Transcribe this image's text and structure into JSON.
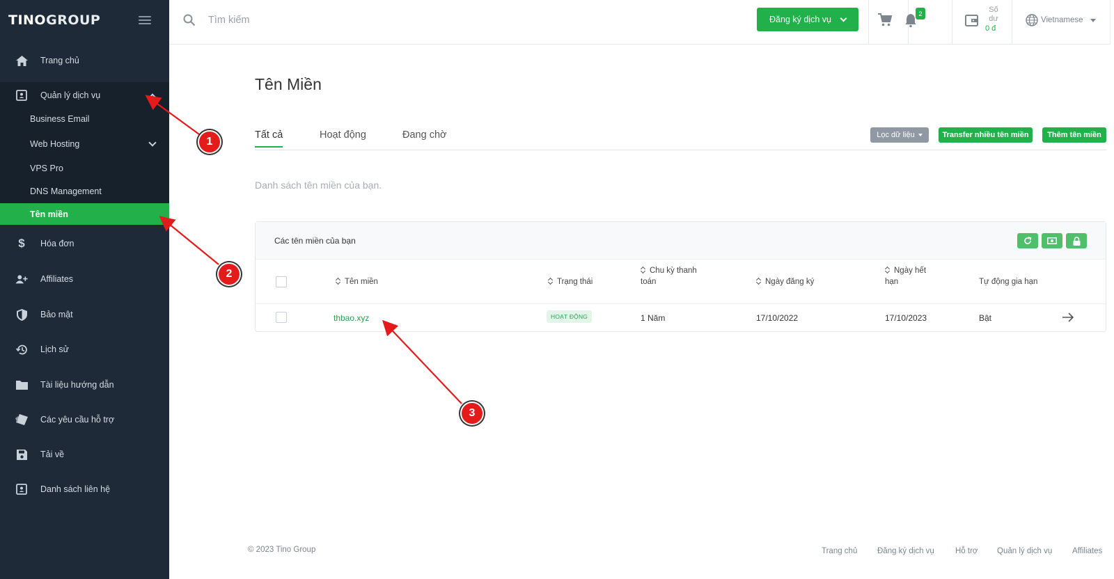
{
  "brand": {
    "logo_part1": "TINO",
    "logo_part2": "GROUP"
  },
  "sidebar": {
    "items": [
      {
        "label": "Trang chủ",
        "icon": "home-icon"
      },
      {
        "label": "Quản lý dịch vụ",
        "icon": "contact-card-icon"
      },
      {
        "label": "Hóa đơn",
        "icon": "dollar-icon"
      },
      {
        "label": "Affiliates",
        "icon": "add-user-icon"
      },
      {
        "label": "Bảo mật",
        "icon": "shield-icon"
      },
      {
        "label": "Lịch sử",
        "icon": "history-icon"
      },
      {
        "label": "Tài liệu hướng dẫn",
        "icon": "folder-icon"
      },
      {
        "label": "Các yêu cầu hỗ trợ",
        "icon": "ticket-icon"
      },
      {
        "label": "Tải về",
        "icon": "save-icon"
      },
      {
        "label": "Danh sách liên hệ",
        "icon": "contact-card-icon"
      }
    ],
    "submenu": [
      {
        "label": "Business Email"
      },
      {
        "label": "Web Hosting"
      },
      {
        "label": "VPS Pro"
      },
      {
        "label": "DNS Management"
      },
      {
        "label": "Tên miền",
        "active": true
      }
    ]
  },
  "topbar": {
    "search_placeholder": "Tìm kiếm",
    "register_label": "Đăng ký dịch vụ",
    "notification_count": "2",
    "balance_label": "Số dư",
    "balance_value": "0 đ",
    "language": "Vietnamese",
    "accent_color": "#22b04b"
  },
  "main": {
    "title": "Tên Miền",
    "tabs": [
      {
        "label": "Tất cả",
        "active": true
      },
      {
        "label": "Hoạt động"
      },
      {
        "label": "Đang chờ"
      }
    ],
    "filter_label": "Lọc dữ liệu",
    "transfer_label": "Transfer nhiều tên miền",
    "add_label": "Thêm tên miền",
    "hint": "Danh sách tên miền của bạn.",
    "card_title": "Các tên miền của bạn",
    "columns": {
      "domain": "Tên miền",
      "status": "Trạng thái",
      "billing_line1": "Chu kỳ thanh",
      "billing_line2": "toán",
      "registered": "Ngày đăng ký",
      "expiry_line1": "Ngày hết",
      "expiry_line2": "hạn",
      "autorenew": "Tự động gia hạn"
    },
    "rows": [
      {
        "domain": "thbao.xyz",
        "status": "HOẠT ĐỘNG",
        "billing": "1 Năm",
        "registered": "17/10/2022",
        "expiry": "17/10/2023",
        "autorenew": "Bật"
      }
    ]
  },
  "footer": {
    "copyright": "© 2023 Tino Group",
    "links": [
      "Trang chủ",
      "Đăng ký dịch vụ",
      "Hỗ trợ",
      "Quản lý dịch vụ",
      "Affiliates"
    ]
  },
  "annotations": [
    "1",
    "2",
    "3"
  ]
}
